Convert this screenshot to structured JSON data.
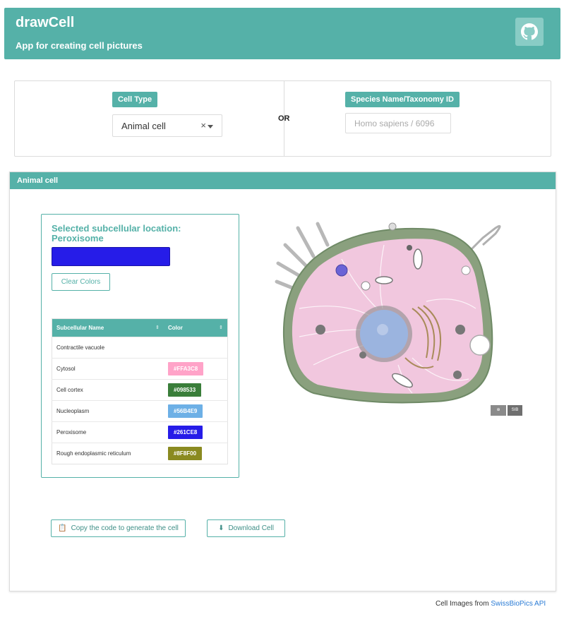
{
  "header": {
    "title": "drawCell",
    "subtitle": "App for creating cell pictures",
    "github_icon": "github-icon"
  },
  "selector": {
    "cell_type_label": "Cell Type",
    "cell_type_value": "Animal cell",
    "clear_symbol": "×",
    "or_label": "OR",
    "species_label": "Species Name/Taxonomy ID",
    "species_placeholder": "Homo sapiens / 6096"
  },
  "panel": {
    "title": "Animal cell",
    "selected_label": "Selected subcellular location:",
    "selected_value": "Peroxisome",
    "selected_color": "#261CE8",
    "clear_colors": "Clear Colors",
    "table": {
      "headers": [
        "Subcellular Name",
        "Color"
      ],
      "rows": [
        {
          "name": "Contractile vacuole",
          "color": ""
        },
        {
          "name": "Cytosol",
          "color": "#FFA3C8"
        },
        {
          "name": "Cell cortex",
          "color": "#098533"
        },
        {
          "name": "Nucleoplasm",
          "color": "#56B4E9"
        },
        {
          "name": "Peroxisome",
          "color": "#261CE8"
        },
        {
          "name": "Rough endoplasmic reticulum",
          "color": "#8F8F00"
        }
      ]
    },
    "copy_button": "Copy the code to generate the cell",
    "download_button": "Download Cell",
    "logo_text": "SIB"
  },
  "footer": {
    "prefix": "Cell Images from",
    "link": "SwissBioPics API"
  },
  "colors": {
    "accent": "#55b1a8",
    "link": "#2a7bd5"
  }
}
